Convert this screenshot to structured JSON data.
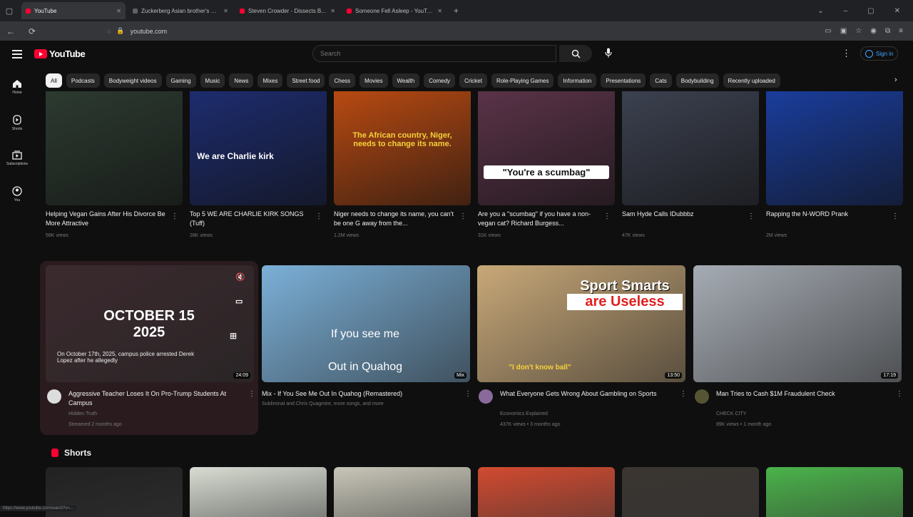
{
  "browser": {
    "tabs": [
      {
        "title": "YouTube",
        "active": true,
        "favicon_color": "#ff0033"
      },
      {
        "title": "Zuckerberg Asian brother's Family Edge - YouTube",
        "active": false,
        "favicon_color": "#5f6368"
      },
      {
        "title": "Steven Crowder - Dissects B...",
        "active": false,
        "favicon_color": "#ff0033"
      },
      {
        "title": "Someone Fell Asleep - YouTube",
        "active": false,
        "favicon_color": "#ff0033"
      }
    ],
    "new_tab": "+",
    "url": "youtube.com"
  },
  "header": {
    "logo_text": "YouTube",
    "search_placeholder": "Search",
    "sign_in": "Sign in"
  },
  "leftnav": [
    {
      "label": "Home",
      "icon": "home-icon"
    },
    {
      "label": "Shorts",
      "icon": "shorts-icon"
    },
    {
      "label": "Subscriptions",
      "icon": "subscriptions-icon"
    },
    {
      "label": "You",
      "icon": "you-icon"
    }
  ],
  "chips": [
    "All",
    "Podcasts",
    "Bodyweight videos",
    "Gaming",
    "Music",
    "News",
    "Mixes",
    "Street food",
    "Chess",
    "Movies",
    "Wealth",
    "Comedy",
    "Cricket",
    "Role-Playing Games",
    "Information",
    "Presentations",
    "Cats",
    "Bodybuilding",
    "Recently uploaded"
  ],
  "row1": [
    {
      "title": "Helping Vegan Gains After His Divorce Be More Attractive",
      "meta": "58K views",
      "thumb_bg": "#2c3a30",
      "caption": ""
    },
    {
      "title": "Top 5 WE ARE CHARLIE KIRK SONGS (Tuff)",
      "meta": "28K views",
      "thumb_bg": "#1d2c6e",
      "caption": "We are Charlie kirk"
    },
    {
      "title": "Niger needs to change its name, you can't be one G away from the...",
      "meta": "1.2M views",
      "thumb_bg": "#b84a12",
      "caption": "The African country, Niger, needs to change its name."
    },
    {
      "title": "Are you a \"scumbag\" if you have a non-vegan cat? Richard Burgess...",
      "meta": "31K views",
      "thumb_bg": "#5a3348",
      "caption": "\"You're a scumbag\""
    },
    {
      "title": "Sam Hyde Calls IDubbbz",
      "meta": "47K views",
      "thumb_bg": "#3c4150",
      "caption": ""
    },
    {
      "title": "Rapping the N-WORD Prank",
      "meta": "2M views",
      "thumb_bg": "#1a3d9c",
      "caption": ""
    }
  ],
  "row2": [
    {
      "title": "Aggressive Teacher Loses It On Pro-Trump Students At Campus",
      "channel": "Hidden Truth",
      "meta": "Streamed 2 months ago",
      "duration": "24:09",
      "thumb_bg": "#3b2a2e",
      "caption": "OCTOBER 15 2025",
      "sub": "On October 17th, 2025, campus police arrested Derek Lopez after he allegedly",
      "avatar": "#ddd"
    },
    {
      "title": "Mix - If You See Me Out In Quahog (Remastered)",
      "channel": "",
      "meta": "Subliminal and Chris Quagmire, more songs, and more",
      "duration": "Mix",
      "thumb_bg": "#7bb0d8",
      "caption": "If you see me",
      "caption2": "Out in Quahog",
      "avatar": ""
    },
    {
      "title": "What Everyone Gets Wrong About Gambling on Sports",
      "channel": "Economics Explained",
      "meta": "437K views • 3 months ago",
      "duration": "13:50",
      "thumb_bg": "#c8a878",
      "caption": "Sport Smarts",
      "caption2": "are Useless",
      "caption3": "\"I don't know ball\"",
      "avatar": "#8a6a9a"
    },
    {
      "title": "Man Tries to Cash $1M Fraudulent Check",
      "channel": "CHECK CITY",
      "meta": "89K views • 1 month ago",
      "duration": "17:19",
      "thumb_bg": "#a6acb4",
      "caption": "",
      "avatar": "#553"
    }
  ],
  "shorts": {
    "title": "Shorts",
    "thumbs": [
      "#222222",
      "#d8dcd2",
      "#c8c6b8",
      "#d24a30",
      "#3a3530",
      "#4ab34a"
    ]
  },
  "status": "https://www.youtube.com/watch?v=..."
}
